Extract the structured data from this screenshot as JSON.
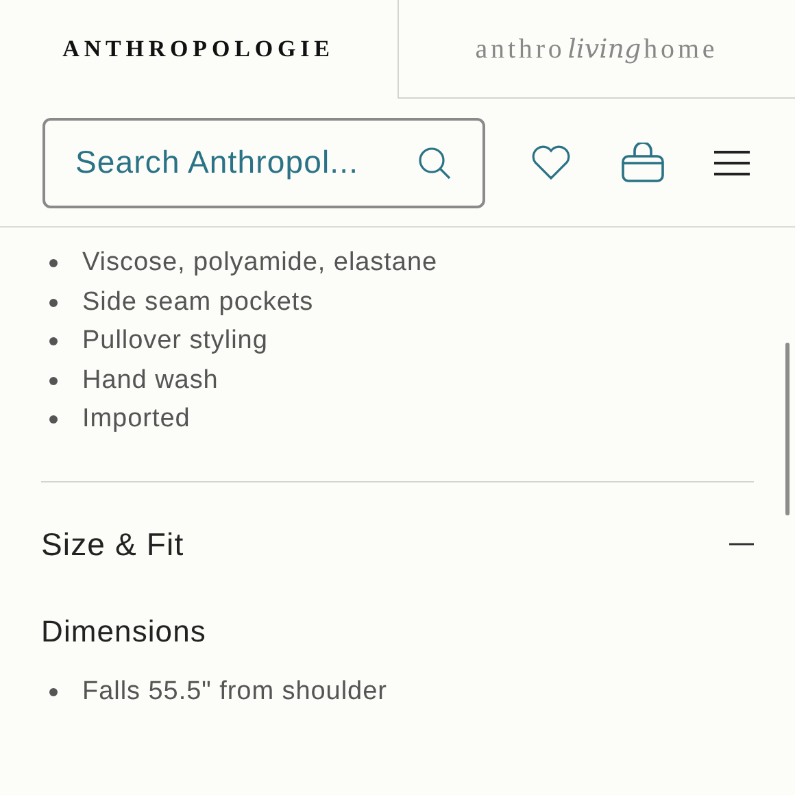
{
  "tabs": [
    {
      "kind": "wordmark",
      "label": "ANTHROPOLOGIE",
      "selected": true
    },
    {
      "kind": "living",
      "parts": [
        "anthro",
        "living",
        "home"
      ],
      "selected": false
    }
  ],
  "search": {
    "placeholder": "Search Anthropol..."
  },
  "details": [
    "Viscose, polyamide, elastane",
    "Side seam pockets",
    "Pullover styling",
    "Hand wash",
    "Imported"
  ],
  "section": {
    "title": "Size & Fit",
    "expanded": true,
    "heading": "Dimensions",
    "items": [
      "Falls 55.5\" from shoulder"
    ]
  }
}
